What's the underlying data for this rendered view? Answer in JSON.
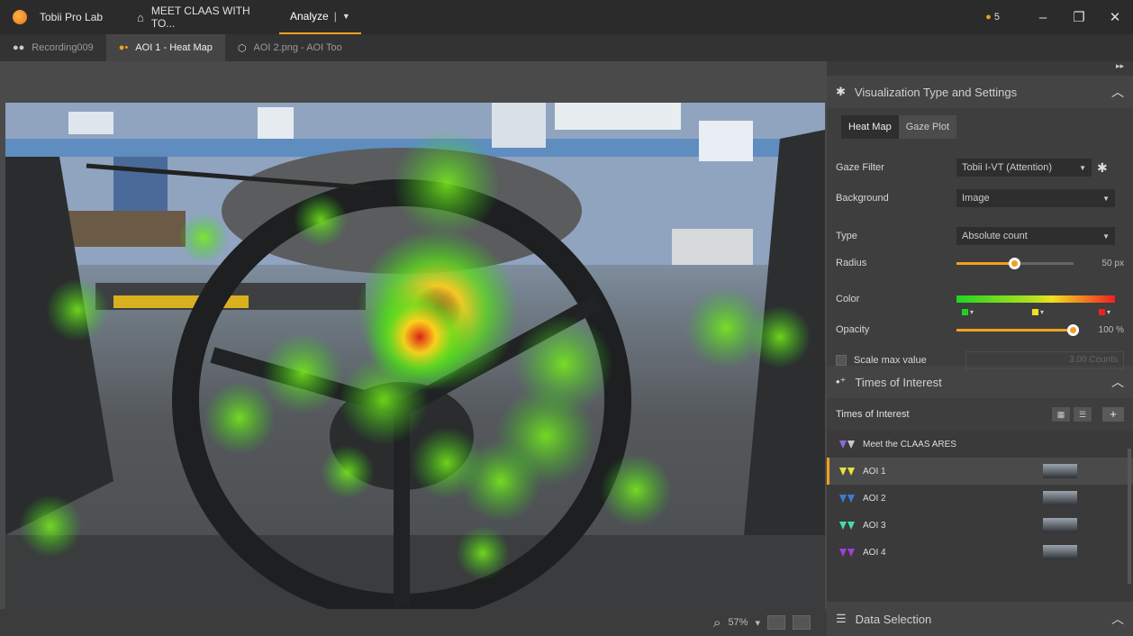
{
  "titlebar": {
    "app_name": "Tobii Pro Lab",
    "project_tab": "MEET CLAAS WITH TO...",
    "analyze_tab": "Analyze",
    "analyze_sep": "|",
    "notification_count": "5",
    "accent_color": "#f0a020"
  },
  "subtabs": [
    {
      "label": "Recording009",
      "icon": "glasses-icon",
      "active": false
    },
    {
      "label": "AOI 1 - Heat Map",
      "icon": "heatmap-icon",
      "active": true
    },
    {
      "label": "AOI 2.png - AOI Too",
      "icon": "aoi-tool-icon",
      "active": false
    }
  ],
  "bottombar": {
    "zoom": "57%"
  },
  "panel": {
    "viz": {
      "title": "Visualization Type and Settings",
      "tabs": [
        "Heat Map",
        "Gaze Plot"
      ],
      "gaze_filter_label": "Gaze Filter",
      "gaze_filter_value": "Tobii I-VT (Attention)",
      "background_label": "Background",
      "background_value": "Image",
      "type_label": "Type",
      "type_value": "Absolute count",
      "radius_label": "Radius",
      "radius_value": "50 px",
      "radius_fraction": 0.5,
      "color_label": "Color",
      "opacity_label": "Opacity",
      "opacity_value": "100 %",
      "opacity_fraction": 1.0,
      "scale_max_label": "Scale max value",
      "scale_max_value": "3.00 Counts"
    },
    "toi": {
      "title": "Times of Interest",
      "list_label": "Times of Interest",
      "items": [
        {
          "label": "Meet the CLAAS ARES",
          "colors": [
            "#8a6ad8",
            "#c8c8c8"
          ],
          "thumb": false
        },
        {
          "label": "AOI 1",
          "colors": [
            "#e8e040",
            "#e8e040"
          ],
          "thumb": true
        },
        {
          "label": "AOI 2",
          "colors": [
            "#3a7ad8",
            "#3a7ad8"
          ],
          "thumb": true
        },
        {
          "label": "AOI 3",
          "colors": [
            "#40e0a0",
            "#40e0a0"
          ],
          "thumb": true
        },
        {
          "label": "AOI 4",
          "colors": [
            "#a040d8",
            "#a040d8"
          ],
          "thumb": true
        }
      ]
    },
    "data_selection": "Data Selection"
  }
}
